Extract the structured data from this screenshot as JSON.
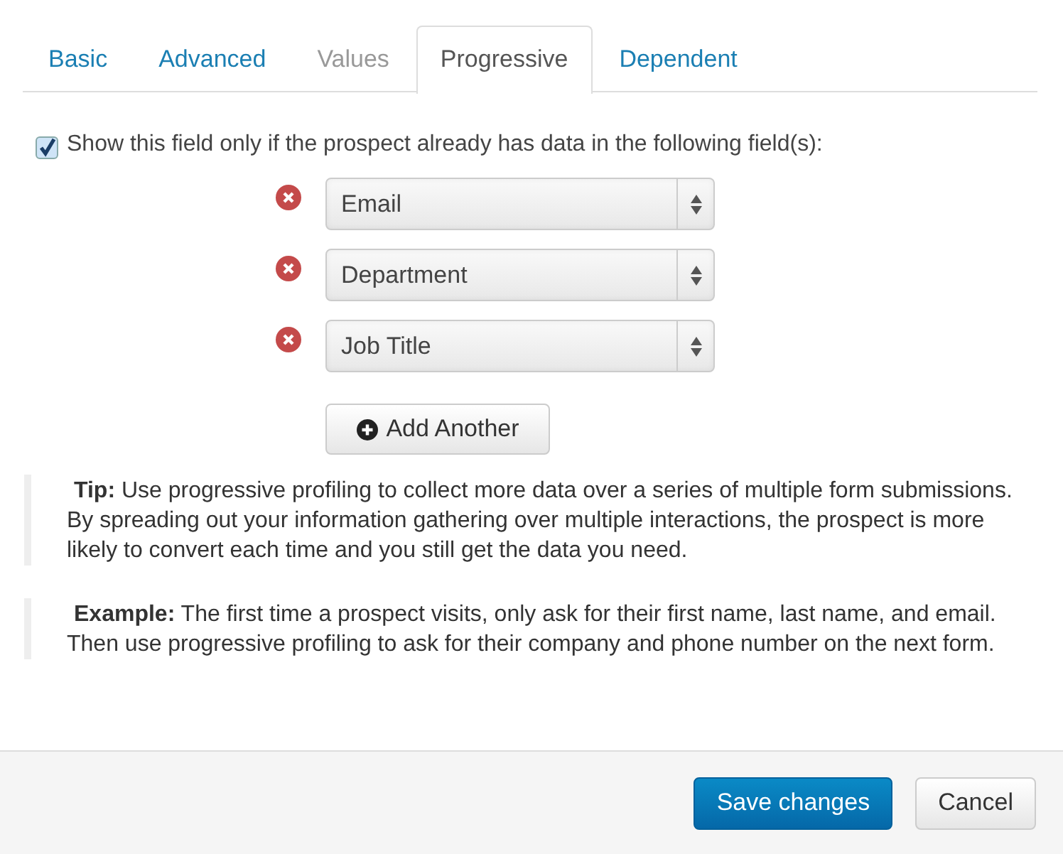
{
  "tabs": [
    {
      "label": "Basic",
      "selected": false,
      "disabled": false
    },
    {
      "label": "Advanced",
      "selected": false,
      "disabled": false
    },
    {
      "label": "Values",
      "selected": false,
      "disabled": true
    },
    {
      "label": "Progressive",
      "selected": true,
      "disabled": false
    },
    {
      "label": "Dependent",
      "selected": false,
      "disabled": false
    }
  ],
  "condition": {
    "label": "Show this field only if the prospect already has data in the following field(s):",
    "checked": true
  },
  "fields": [
    {
      "value": "Email"
    },
    {
      "value": "Department"
    },
    {
      "value": "Job Title"
    }
  ],
  "add_button": {
    "label": "Add Another"
  },
  "notes": [
    {
      "text": "**Tip:** Use progressive profiling to collect more data over a series of multiple form submissions. By spreading out your information gathering over multiple interactions, the prospect is more likely to convert each time and you still get the data you need."
    },
    {
      "text": "**Example:** The first time a prospect visits, only ask for their first name, last name, and email. Then use progressive profiling to ask for their company and phone number on the next form."
    }
  ],
  "footer_buttons": [
    {
      "label": "Save changes",
      "kind": "primary"
    },
    {
      "label": "Cancel",
      "kind": "default"
    }
  ]
}
